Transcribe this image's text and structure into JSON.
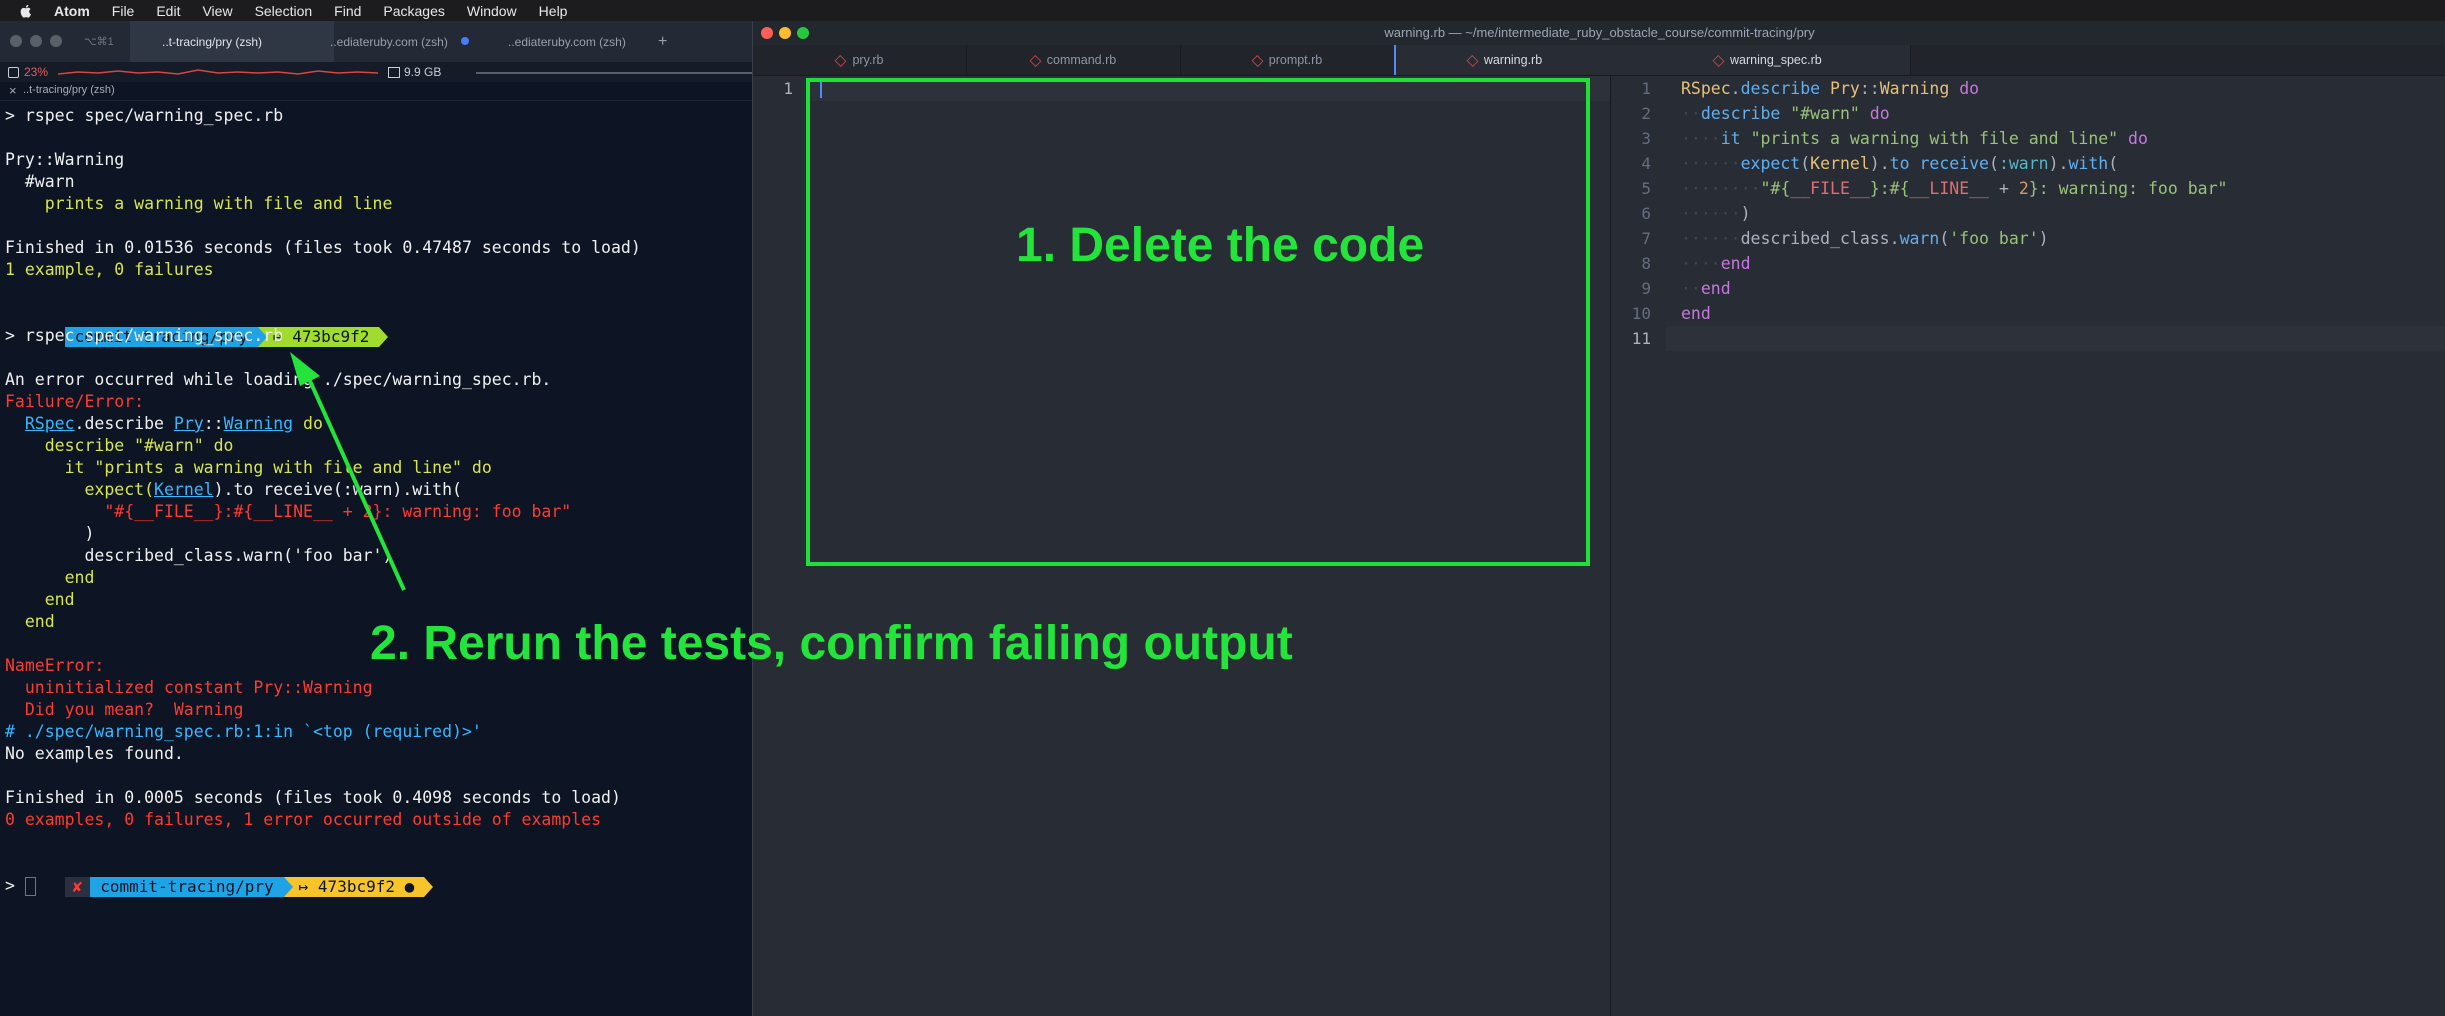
{
  "menubar": {
    "items": [
      "Atom",
      "File",
      "Edit",
      "View",
      "Selection",
      "Find",
      "Packages",
      "Window",
      "Help"
    ]
  },
  "iterm": {
    "tabs": [
      {
        "label": "..t-tracing/pry (zsh)",
        "shortcut": "⌥⌘1"
      },
      {
        "label": "..ediateruby.com (zsh)"
      },
      {
        "label": "..ediateruby.com (zsh)"
      }
    ],
    "new_tab": "+",
    "status": {
      "cpu": "23%",
      "mem": "9.9 GB"
    },
    "session_title": "..t-tracing/pry (zsh)",
    "prompt": {
      "dir": "commit-tracing/pry",
      "git": "473bc9f2",
      "git_prefix": "↦",
      "dirty_mark": "●",
      "error_mark": "✘"
    },
    "lines": {
      "cmd1": "> rspec spec/warning_spec.rb",
      "pry_warning": "Pry::Warning",
      "warn": "  #warn",
      "prints": "    prints a warning with file and line",
      "finished1": "Finished in 0.01536 seconds (files took 0.47487 seconds to load)",
      "result1": "1 example, 0 failures",
      "cmd2": "> rspec spec/warning_spec.rb",
      "error_loading": "An error occurred while loading ./spec/warning_spec.rb.",
      "failure": "Failure/Error:",
      "fe_rspec": "RSpec",
      "fe_describe": ".describe ",
      "fe_pry": "Pry",
      "fe_colons": "::",
      "fe_warning": "Warning",
      "fe_do": " do",
      "fe_describe_warn": "    describe \"#warn\" do",
      "fe_it": "      it \"prints a warning with file and line\" do",
      "fe_expect_a": "        expect(",
      "fe_kernel": "Kernel",
      "fe_expect_b": ").to receive(:warn).with(",
      "fe_string": "          \"#{__FILE__}:#{__LINE__ + 2}: warning: foo bar\"",
      "fe_paren": "        )",
      "fe_described": "        described_class.warn('foo bar')",
      "fe_end1": "      end",
      "fe_end2": "    end",
      "fe_end3": "  end",
      "name_error": "NameError:",
      "uninit": "  uninitialized constant Pry::Warning",
      "did_you_mean": "  Did you mean?  Warning",
      "trace": "# ./spec/warning_spec.rb:1:in `<top (required)>'",
      "no_examples": "No examples found.",
      "finished2": "Finished in 0.0005 seconds (files took 0.4098 seconds to load)",
      "result2": "0 examples, 0 failures, 1 error occurred outside of examples",
      "final_prompt": ">"
    }
  },
  "atom": {
    "title": "warning.rb — ~/me/intermediate_ruby_obstacle_course/commit-tracing/pry",
    "tabs": [
      "pry.rb",
      "command.rb",
      "prompt.rb",
      "warning.rb"
    ],
    "right_tab": "warning_spec.rb",
    "left_line_numbers": [
      "1"
    ],
    "right_line_numbers": [
      "1",
      "2",
      "3",
      "4",
      "5",
      "6",
      "7",
      "8",
      "9",
      "10",
      "11"
    ],
    "code": {
      "l1": {
        "a": "RSpec",
        "b": ".",
        "c": "describe",
        "d": " ",
        "e": "Pry",
        "f": "::",
        "g": "Warning",
        "h": " do"
      },
      "l2": {
        "a": "describe",
        "b": " ",
        "c": "\"#warn\"",
        "d": " do"
      },
      "l3": {
        "a": "it",
        "b": " ",
        "c": "\"prints a warning with file and line\"",
        "d": " do"
      },
      "l4": {
        "a": "expect",
        "b": "(",
        "c": "Kernel",
        "d": ").",
        "e": "to",
        "f": " ",
        "g": "receive",
        "h": "(",
        "i": ":warn",
        "j": ").",
        "k": "with",
        "l": "("
      },
      "l5": {
        "a": "\"#{",
        "b": "__FILE__",
        "c": "}:#{",
        "d": "__LINE__",
        "e": " + ",
        "f": "2",
        "g": "}: warning: foo bar\""
      },
      "l6": {
        "a": ")"
      },
      "l7": {
        "a": "described_class",
        "b": ".",
        "c": "warn",
        "d": "(",
        "e": "'foo bar'",
        "f": ")"
      },
      "l8": {
        "a": "end"
      },
      "l9": {
        "a": "end"
      },
      "l10": {
        "a": "end"
      }
    }
  },
  "annotations": {
    "step1": "1. Delete the code",
    "step2": "2. Rerun the tests, confirm failing output"
  },
  "colors": {
    "annotation": "#22e43b",
    "prompt_blue": "#1fa3e5",
    "prompt_green": "#9fdc2d",
    "prompt_yellow": "#f7c52b"
  }
}
